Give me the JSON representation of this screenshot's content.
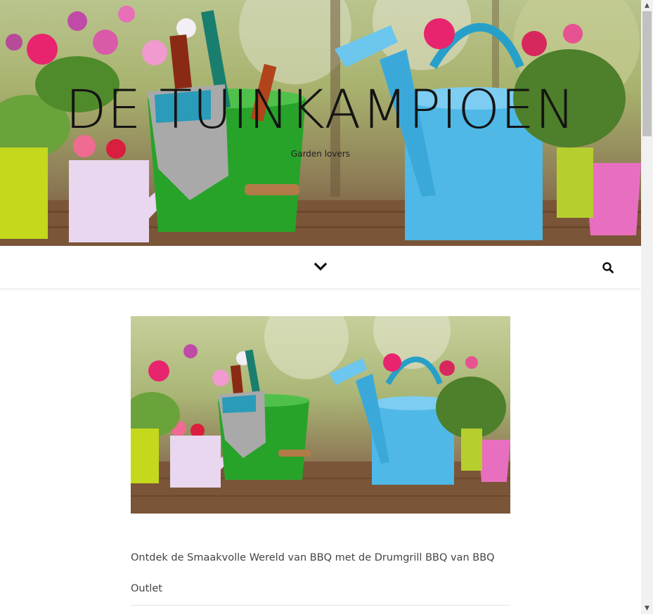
{
  "header": {
    "site_title": "DE TUINKAMPIOEN",
    "tagline": "Garden lovers",
    "banner_image": "garden-tools-flowers-watering-can-photo"
  },
  "nav": {
    "menu_icon": "chevron-down-icon",
    "search_icon": "search-icon"
  },
  "main": {
    "featured_image": "garden-tools-flowers-watering-can-photo",
    "post_title": "Ontdek de Smaakvolle Wereld van BBQ met de Drumgrill BBQ van BBQ Outlet"
  },
  "scrollbar": {
    "up_arrow": "▲",
    "down_arrow": "▼"
  },
  "colors": {
    "title_text": "#141414",
    "post_text": "#444444",
    "watering_can_blue": "#4fb8e6",
    "bucket_green": "#27a32a",
    "pot_pink": "#e86fc0",
    "pot_lime": "#c4d81c"
  }
}
